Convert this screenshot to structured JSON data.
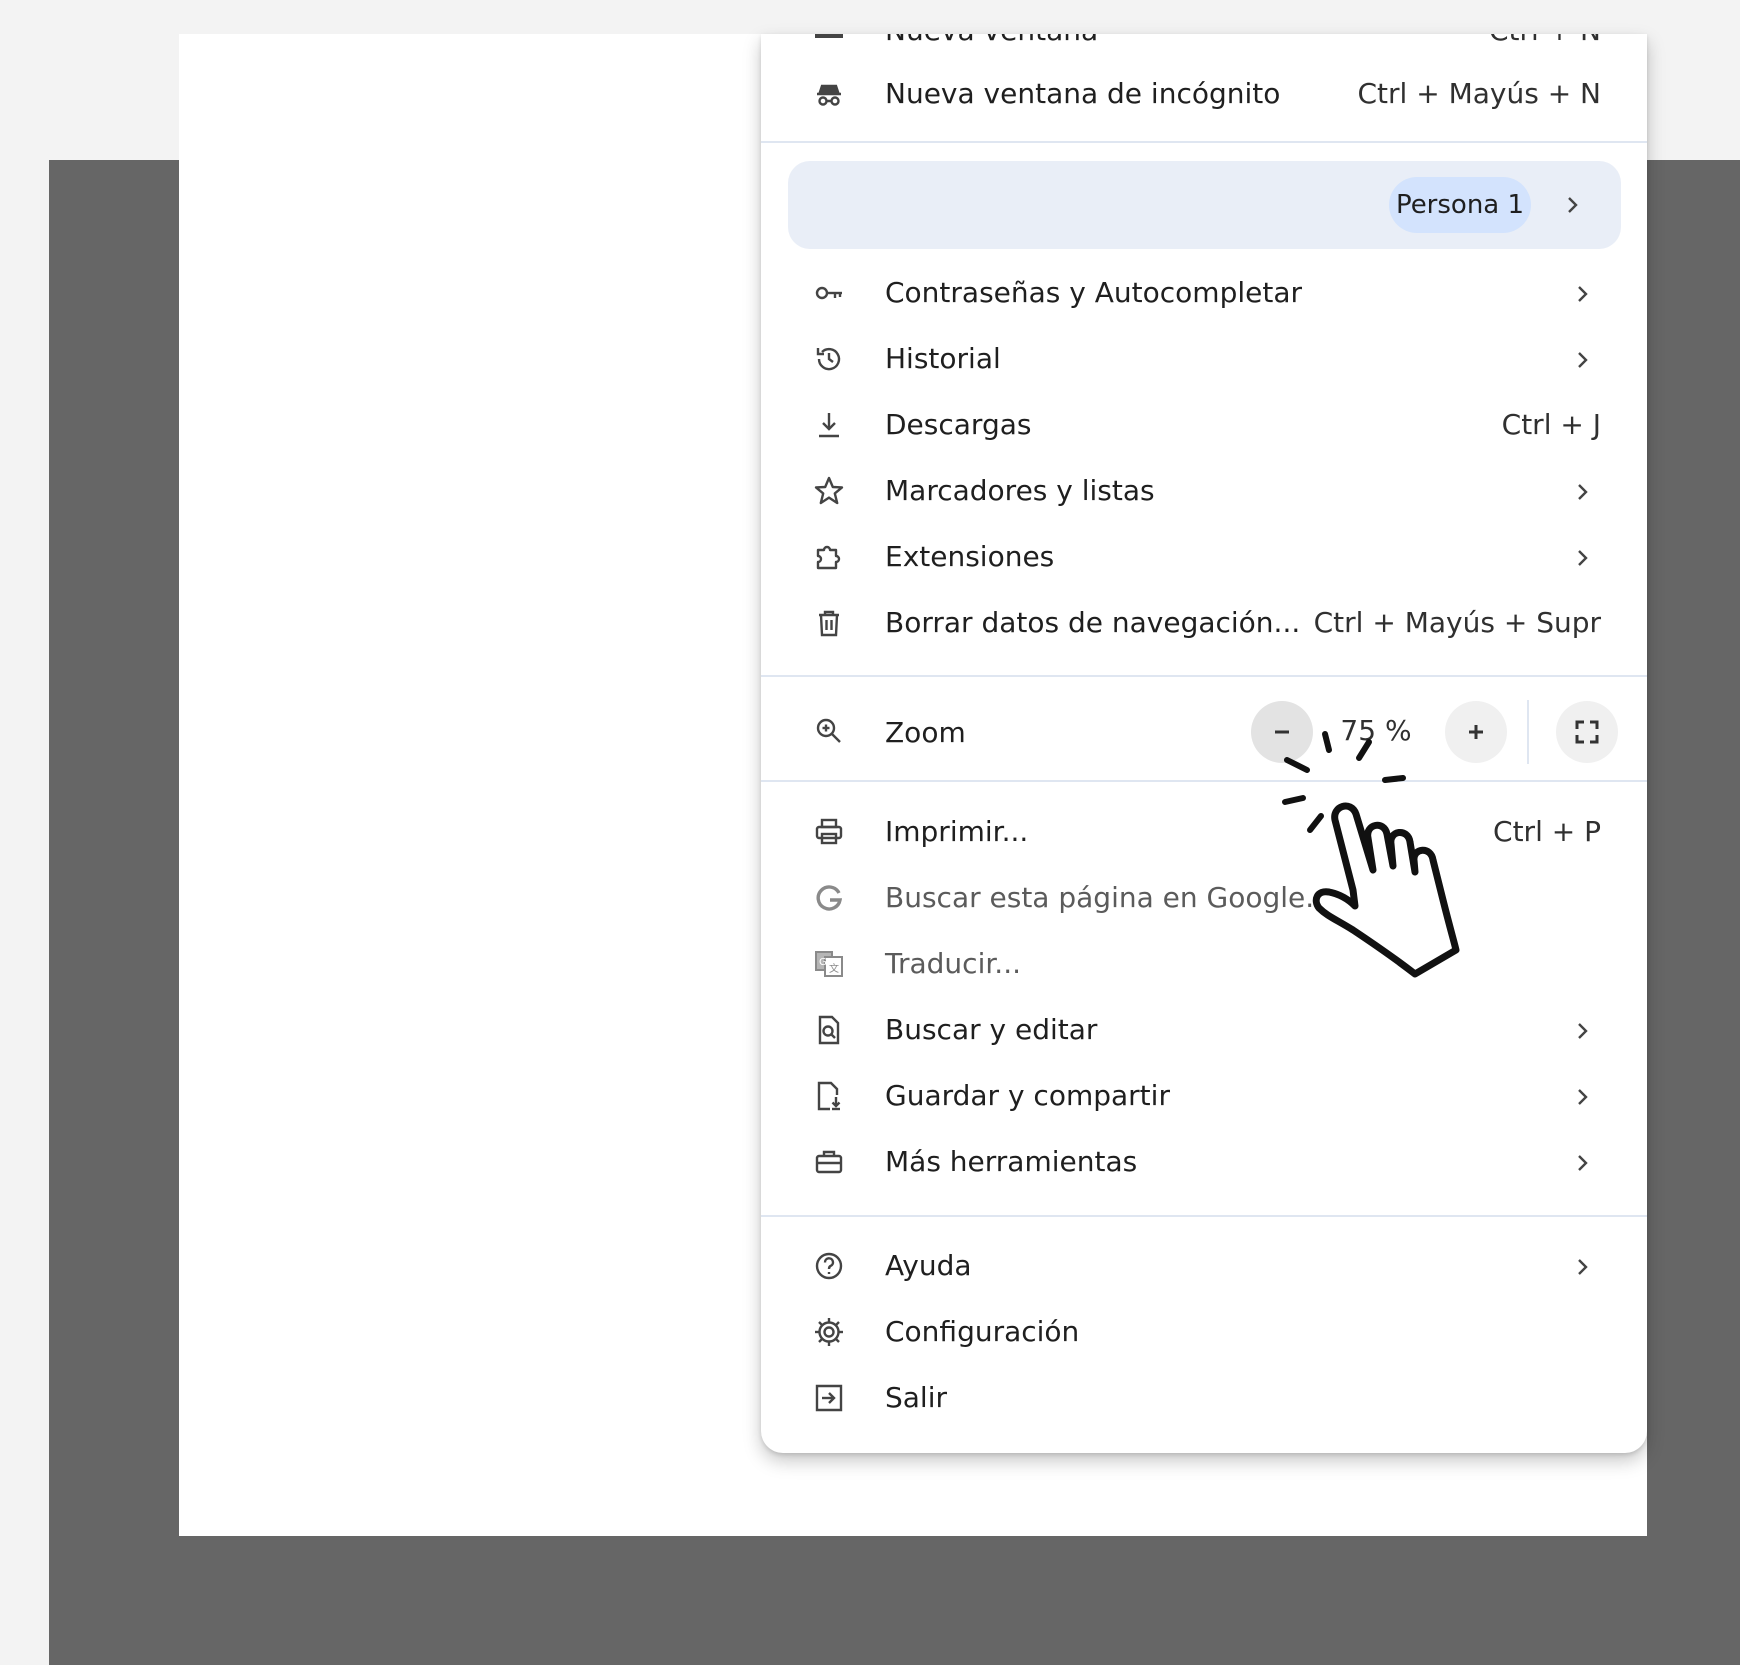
{
  "menu": {
    "top_item": {
      "label": "Nueva ventana",
      "shortcut": "Ctrl + N"
    },
    "incognito": {
      "label": "Nueva ventana de incógnito",
      "shortcut": "Ctrl + Mayús + N",
      "icon": "incognito-icon"
    },
    "profile": {
      "name": "Persona 1"
    },
    "group1": [
      {
        "label": "Contraseñas y Autocompletar",
        "icon": "key-icon",
        "submenu": true
      },
      {
        "label": "Historial",
        "icon": "history-icon",
        "submenu": true
      },
      {
        "label": "Descargas",
        "icon": "download-icon",
        "shortcut": "Ctrl + J"
      },
      {
        "label": "Marcadores y listas",
        "icon": "star-icon",
        "submenu": true
      },
      {
        "label": "Extensiones",
        "icon": "puzzle-icon",
        "submenu": true
      },
      {
        "label": "Borrar datos de navegación...",
        "icon": "trash-icon",
        "shortcut": "Ctrl + Mayús + Supr"
      }
    ],
    "zoom": {
      "label": "Zoom",
      "value": "75 %",
      "icon": "zoom-icon"
    },
    "group2": [
      {
        "label": "Imprimir...",
        "icon": "print-icon",
        "shortcut": "Ctrl + P"
      },
      {
        "label": "Buscar esta página en Google...",
        "icon": "google-icon"
      },
      {
        "label": "Traducir...",
        "icon": "translate-icon"
      },
      {
        "label": "Buscar y editar",
        "icon": "find-icon",
        "submenu": true
      },
      {
        "label": "Guardar y compartir",
        "icon": "save-share-icon",
        "submenu": true
      },
      {
        "label": "Más herramientas",
        "icon": "toolbox-icon",
        "submenu": true
      }
    ],
    "group3": [
      {
        "label": "Ayuda",
        "icon": "help-icon",
        "submenu": true
      },
      {
        "label": "Configuración",
        "icon": "gear-icon"
      },
      {
        "label": "Salir",
        "icon": "exit-icon"
      }
    ]
  },
  "colors": {
    "backdrop": "#666666",
    "profile_highlight": "#e9eef7",
    "profile_pill": "#d3e3fd",
    "separator": "#dfe6f1"
  }
}
